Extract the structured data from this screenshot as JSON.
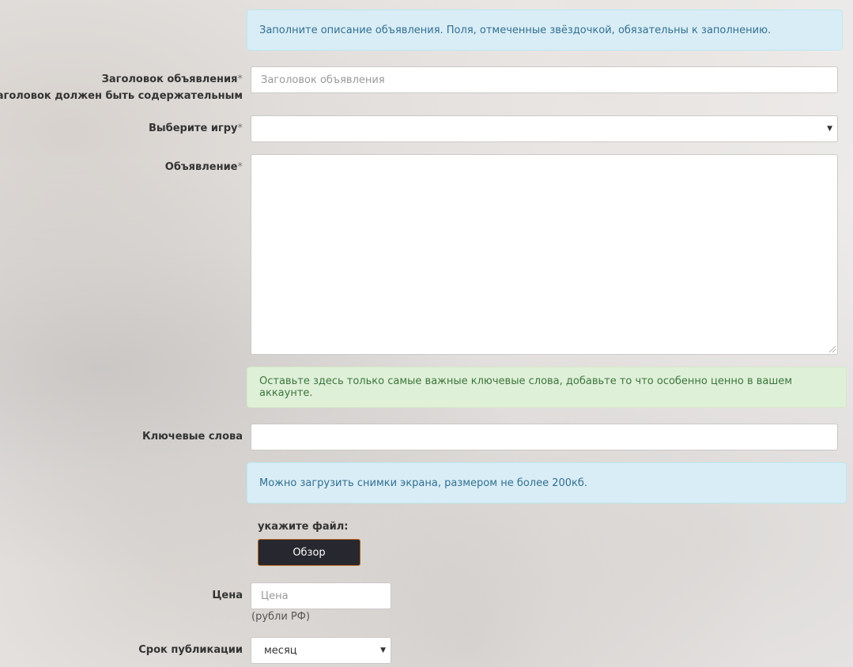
{
  "info_alert": "Заполните описание объявления. Поля, отмеченные звёздочкой, обязательны к заполнению.",
  "title_field": {
    "label": "Заголовок объявления",
    "required_mark": "*",
    "hint": "Заголовок должен быть содержательным",
    "placeholder": "Заголовок объявления",
    "value": ""
  },
  "game_field": {
    "label": "Выберите игру",
    "required_mark": "*",
    "selected": ""
  },
  "description_field": {
    "label": "Объявление",
    "required_mark": "*",
    "value": ""
  },
  "keywords_alert": "Оставьте здесь только самые важные ключевые слова, добавьте то что особенно ценно в вашем аккаунте.",
  "keywords_field": {
    "label": "Ключевые слова",
    "value": ""
  },
  "screenshots_alert": "Можно загрузить снимки экрана, размером не более 200кб.",
  "file_upload": {
    "label": "укажите файл:",
    "button_label": "Обзор"
  },
  "price_field": {
    "label": "Цена",
    "placeholder": "Цена",
    "value": "",
    "unit_hint": "(рубли РФ)"
  },
  "period_field": {
    "label": "Срок публикации",
    "selected": "месяц"
  },
  "icons": {
    "select_caret": "chevron-down-icon",
    "textarea_resize": "resize-grip-icon"
  },
  "colors": {
    "info_bg": "#d9edf7",
    "info_text": "#31708f",
    "success_bg": "#dff0d8",
    "success_text": "#3c763d",
    "button_bg": "#27272f",
    "button_border": "#b5651d"
  }
}
